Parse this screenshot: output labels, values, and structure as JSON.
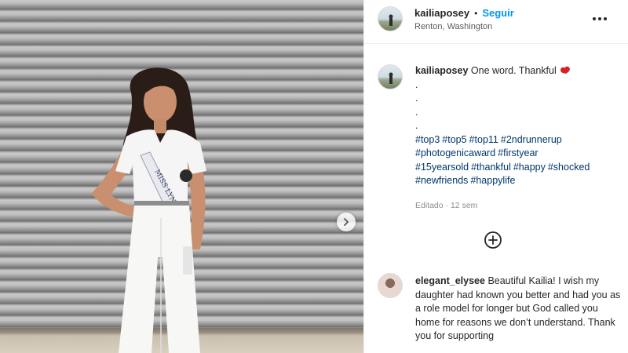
{
  "post": {
    "username": "kailiaposey",
    "separator": "•",
    "follow_label": "Seguir",
    "location": "Renton, Washington",
    "more_icon": "more-horizontal-icon"
  },
  "caption": {
    "username": "kailiaposey",
    "text": "One word. Thankful",
    "emoji_icon": "red-heart-icon",
    "ellipsis_lines": [
      ".",
      ".",
      ".",
      "."
    ],
    "hashtags": [
      "#top3",
      "#top5",
      "#top11",
      "#2ndrunnerup",
      "#photogenicaward",
      "#firstyear",
      "#15yearsold",
      "#thankful",
      "#happy",
      "#shocked",
      "#newfriends",
      "#happylife"
    ],
    "edited_label": "Editado",
    "meta_separator": "·",
    "time_ago": "12 sem"
  },
  "load_more_icon": "plus-circle-icon",
  "carousel_next_icon": "chevron-right-icon",
  "comments": [
    {
      "username": "elegant_elysee",
      "text": "Beautiful Kailia! I wish my daughter had known you better and had you as a role model for longer but God called you home for reasons we don’t understand. Thank you for supporting"
    }
  ],
  "colors": {
    "link_blue": "#0095f6",
    "hashtag_blue": "#00376b",
    "muted_text": "#8e8e8e"
  }
}
